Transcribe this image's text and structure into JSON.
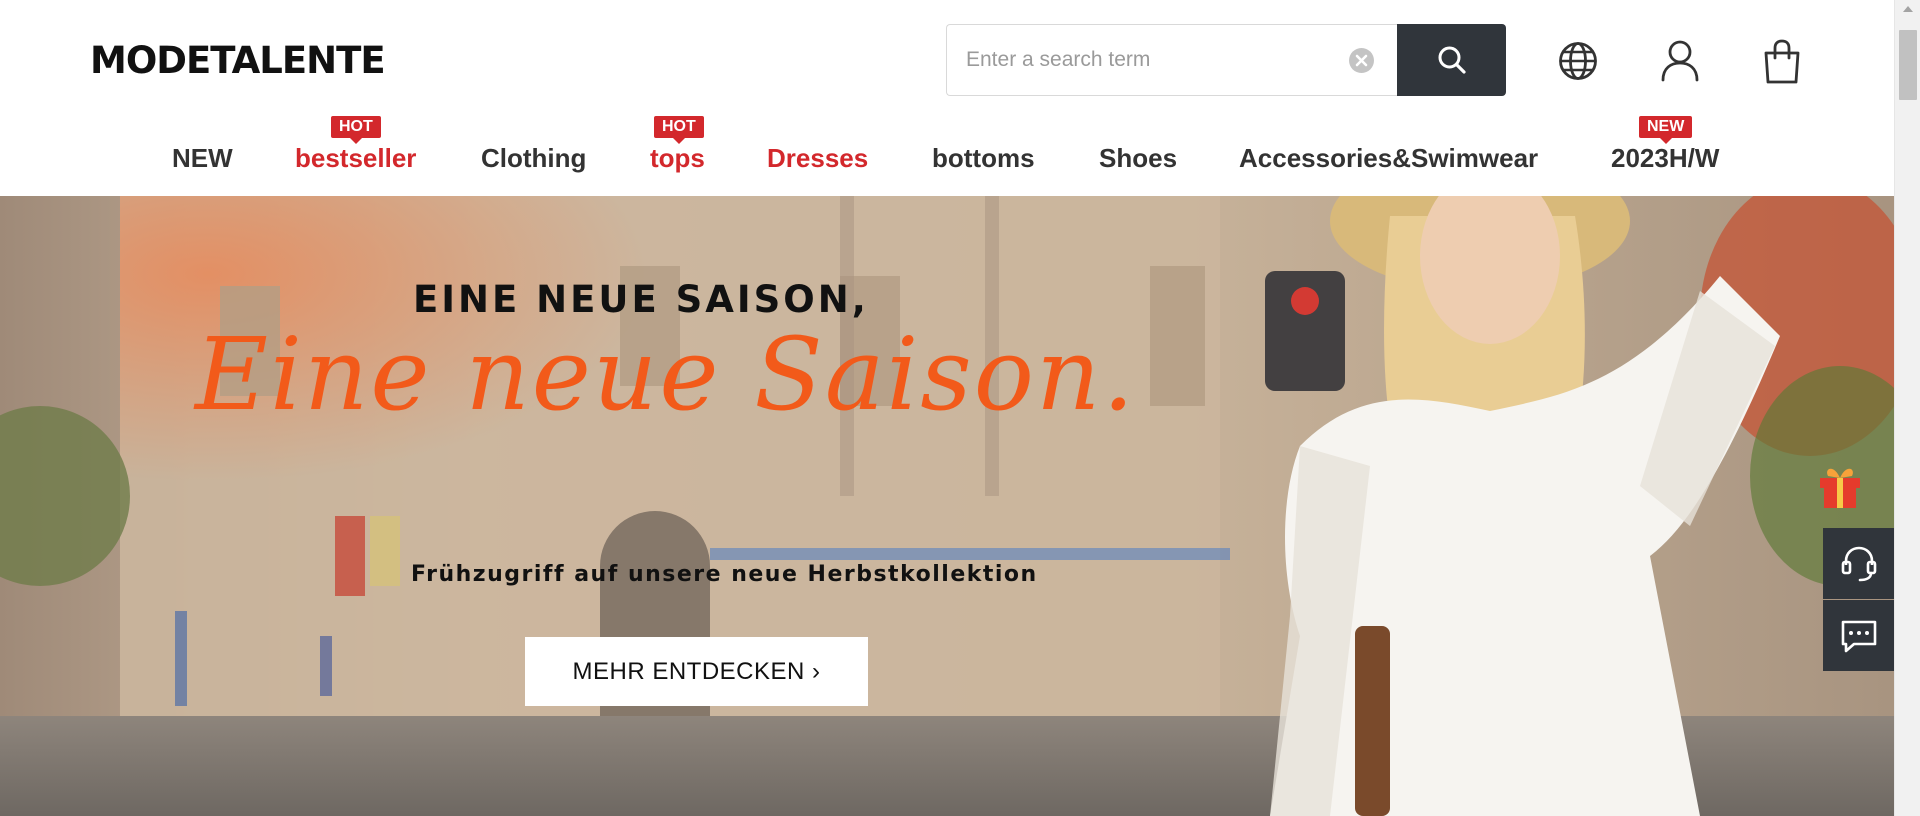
{
  "header": {
    "logo": "MODETALENTE",
    "search": {
      "placeholder": "Enter a search term",
      "value": ""
    },
    "icons": [
      "globe-icon",
      "account-icon",
      "shopping-bag-icon"
    ]
  },
  "nav": {
    "items": [
      {
        "label": "NEW",
        "badge": null
      },
      {
        "label": "bestseller",
        "badge": "HOT"
      },
      {
        "label": "Clothing",
        "badge": null
      },
      {
        "label": "tops",
        "badge": "HOT"
      },
      {
        "label": "Dresses",
        "badge": null
      },
      {
        "label": "bottoms",
        "badge": null
      },
      {
        "label": "Shoes",
        "badge": null
      },
      {
        "label": "Accessories&Swimwear",
        "badge": null
      },
      {
        "label": "2023H/W",
        "badge": "NEW"
      }
    ]
  },
  "hero": {
    "headline": "EINE NEUE SAISON,",
    "script": "Eine neue Saison.",
    "subtitle": "Frühzugriff auf unsere neue Herbstkollektion",
    "cta": "MEHR ENTDECKEN ›"
  },
  "floating": [
    "gift-icon",
    "customer-service-icon",
    "chat-icon"
  ],
  "colors": {
    "accent_red": "#d3282c",
    "script_orange": "#f25a1a",
    "dark_button": "#30353b",
    "nav_text": "#333333"
  }
}
